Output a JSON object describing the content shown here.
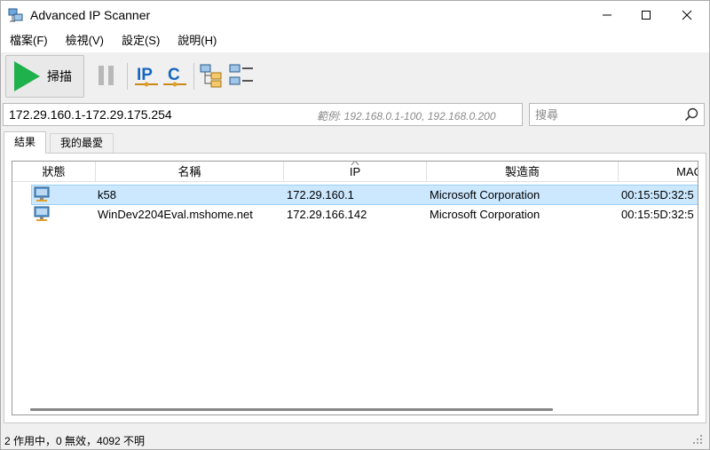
{
  "window": {
    "title": "Advanced IP Scanner"
  },
  "menu": [
    "檔案(F)",
    "檢視(V)",
    "設定(S)",
    "說明(H)"
  ],
  "toolbar": {
    "scan_label": "掃描"
  },
  "range": {
    "value": "172.29.160.1-172.29.175.254",
    "hint": "範例: 192.168.0.1-100, 192.168.0.200"
  },
  "search": {
    "placeholder": "搜尋"
  },
  "tabs": [
    {
      "label": "結果",
      "active": true
    },
    {
      "label": "我的最愛",
      "active": false
    }
  ],
  "table": {
    "columns": [
      "狀態",
      "名稱",
      "IP",
      "製造商",
      "MAC"
    ],
    "rows": [
      {
        "name": "k58",
        "ip": "172.29.160.1",
        "manufacturer": "Microsoft Corporation",
        "mac": "00:15:5D:32:5",
        "selected": true
      },
      {
        "name": "WinDev2204Eval.mshome.net",
        "ip": "172.29.166.142",
        "manufacturer": "Microsoft Corporation",
        "mac": "00:15:5D:32:5",
        "selected": false
      }
    ]
  },
  "status": {
    "text": "2 作用中，0 無效，4092 不明"
  },
  "colors": {
    "selection": "#cce8ff",
    "selection_border": "#99d1ff",
    "scan_green": "#1fb14b",
    "ip_blue": "#1565c0"
  }
}
